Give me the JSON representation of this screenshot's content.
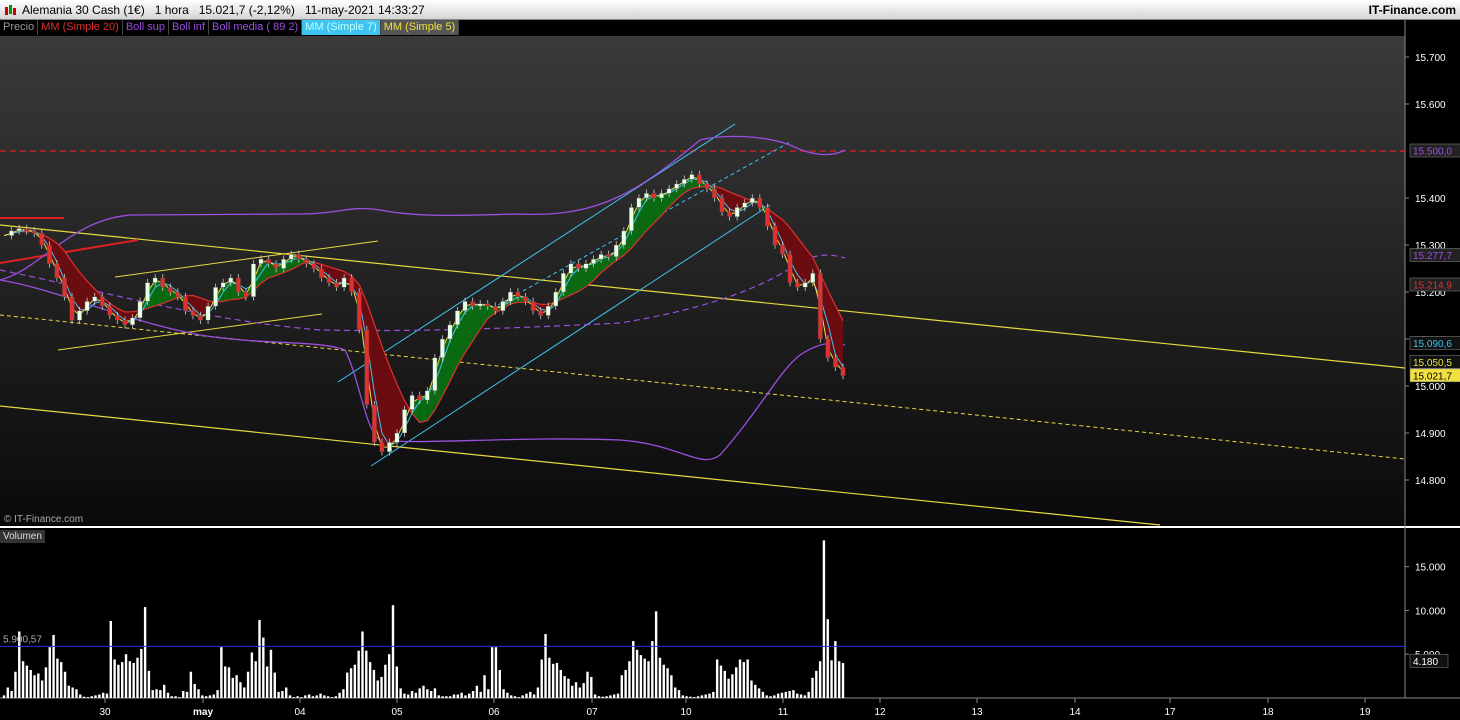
{
  "window": {
    "title": "Alemania 30 Cash (1€)   1 hora   15.021,7 (-2,12%)   11-may-2021 14:33:27",
    "brand": "IT-Finance.com",
    "watermark": "© IT-Finance.com"
  },
  "legend": [
    {
      "label": "Precio",
      "color": "#9a9a9a",
      "bg": "#000000"
    },
    {
      "label": "MM (Simple 20)",
      "color": "#e03030",
      "bg": "#000000"
    },
    {
      "label": "Boll sup",
      "color": "#9a4fe0",
      "bg": "#000000"
    },
    {
      "label": "Boll inf",
      "color": "#9a4fe0",
      "bg": "#000000"
    },
    {
      "label": "Boll media ( 89 2)",
      "color": "#9a4fe0",
      "bg": "#000000"
    },
    {
      "label": "MM (Simple 7)",
      "color": "#3fc3f0",
      "bg": "#3fc3f0"
    },
    {
      "label": "MM (Simple 5)",
      "color": "#f0e040",
      "bg": "#555555"
    }
  ],
  "volume_panel": {
    "label": "Volumen",
    "avg_label": "5.900,57",
    "current_label": "4.180"
  },
  "chart_data": [
    {
      "type": "candlestick",
      "y_ticks": [
        15700,
        15600,
        15500,
        15400,
        15300,
        15200,
        15100,
        15000,
        14900,
        14800
      ],
      "y_tick_labels": [
        "15.700",
        "15.600",
        "15.400",
        "15.300",
        "15.200",
        "15.100",
        "15.000",
        "14.900",
        "14.800"
      ],
      "x_labels": [
        "30",
        "may",
        "04",
        "05",
        "06",
        "07",
        "10",
        "11",
        "12",
        "13",
        "14",
        "17",
        "18",
        "19"
      ],
      "price_tags": [
        {
          "label": "15.500,0",
          "value": 15500,
          "bg": "#222",
          "color": "#9a4fe0"
        },
        {
          "label": "15.277,7",
          "value": 15277.7,
          "bg": "#222",
          "color": "#9a4fe0"
        },
        {
          "label": "15.214,9",
          "value": 15214.9,
          "bg": "#222",
          "color": "#e03030"
        },
        {
          "label": "15.090,6",
          "value": 15090.6,
          "bg": "#111",
          "color": "#3fc3f0"
        },
        {
          "label": "15.050,5",
          "value": 15050.5,
          "bg": "#111",
          "color": "#f0e040"
        },
        {
          "label": "15.021,7",
          "value": 15021.7,
          "bg": "#f0e040",
          "color": "#000"
        }
      ],
      "resistance_line": 15500,
      "close_path": [
        15320,
        15330,
        15335,
        15330,
        15325,
        15300,
        15260,
        15230,
        15190,
        15140,
        15160,
        15180,
        15190,
        15170,
        15150,
        15140,
        15130,
        15145,
        15180,
        15220,
        15230,
        15210,
        15200,
        15190,
        15160,
        15150,
        15140,
        15170,
        15210,
        15220,
        15230,
        15200,
        15190,
        15260,
        15270,
        15260,
        15250,
        15270,
        15280,
        15270,
        15260,
        15250,
        15230,
        15220,
        15210,
        15230,
        15200,
        15120,
        14960,
        14880,
        14860,
        14880,
        14900,
        14950,
        14980,
        14970,
        14990,
        15060,
        15100,
        15130,
        15160,
        15180,
        15170,
        15175,
        15170,
        15160,
        15180,
        15200,
        15190,
        15180,
        15160,
        15150,
        15170,
        15200,
        15240,
        15260,
        15250,
        15260,
        15270,
        15280,
        15275,
        15300,
        15330,
        15380,
        15400,
        15410,
        15400,
        15410,
        15420,
        15430,
        15440,
        15450,
        15430,
        15420,
        15400,
        15370,
        15360,
        15380,
        15390,
        15400,
        15380,
        15340,
        15300,
        15280,
        15220,
        15210,
        15220,
        15240,
        15100,
        15060,
        15040,
        15022
      ]
    },
    {
      "type": "bar",
      "title": "Volumen",
      "y_tick_labels": [
        "15.000",
        "10.000",
        "5.000"
      ],
      "values": [
        300,
        1200,
        800,
        3000,
        7600,
        4200,
        3700,
        3200,
        2600,
        2800,
        2000,
        3500,
        5800,
        7200,
        4500,
        4100,
        3000,
        1400,
        1200,
        1000,
        400,
        150,
        100,
        200,
        300,
        400,
        600,
        500,
        8800,
        4400,
        3800,
        4100,
        5000,
        4200,
        4000,
        4600,
        5600,
        10400,
        3100,
        900,
        1000,
        900,
        1500,
        600,
        200,
        200,
        100,
        800,
        700,
        3000,
        1600,
        1000,
        300,
        200,
        300,
        400,
        900,
        5800,
        3600,
        3500,
        2300,
        2600,
        1800,
        1200,
        3000,
        5200,
        4200,
        8900,
        6900,
        3600,
        5500,
        2900,
        700,
        800,
        1200,
        300,
        100,
        200,
        100,
        300,
        400,
        200,
        300,
        500,
        300,
        200,
        100,
        200,
        600,
        1000,
        2900,
        3400,
        3800,
        5400,
        7600,
        5400,
        4100,
        3200,
        2000,
        2400,
        3800,
        5000,
        10600,
        3600,
        1100,
        500,
        400,
        800,
        600,
        1100,
        1400,
        1000,
        800,
        1100,
        300,
        200,
        200,
        200,
        400,
        400,
        600,
        300,
        500,
        800,
        1400,
        700,
        2600,
        1000,
        5800,
        5800,
        3200,
        1000,
        600,
        300,
        200,
        100,
        300,
        500,
        700,
        400,
        1200,
        4400,
        7300,
        4600,
        3900,
        4000,
        3200,
        2500,
        2200,
        1400,
        1800,
        1200,
        1700,
        3000,
        2400,
        400,
        200,
        150,
        200,
        300,
        400,
        500,
        2600,
        3200,
        4200,
        6500,
        5500,
        4900,
        4500,
        4200,
        6500,
        9900,
        4600,
        3800,
        3400,
        2600,
        1200,
        900,
        300,
        200,
        150,
        100,
        200,
        300,
        400,
        500,
        700,
        4400,
        3700,
        3100,
        2200,
        2700,
        3500,
        4400,
        4100,
        4400,
        2000,
        1500,
        1100,
        700,
        300,
        200,
        300,
        500,
        600,
        700,
        800,
        900,
        500,
        400,
        300,
        700,
        2300,
        3100,
        4200,
        18000,
        9000,
        4300,
        6500,
        4200,
        4000
      ]
    }
  ]
}
